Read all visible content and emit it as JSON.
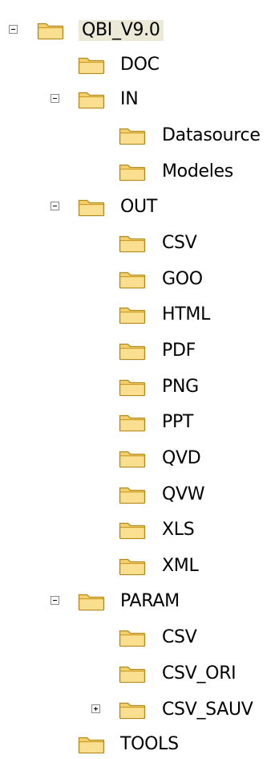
{
  "tree": {
    "root": {
      "label": "QBI_V9.0",
      "expanded": true
    },
    "doc": {
      "label": "DOC"
    },
    "in": {
      "label": "IN",
      "expanded": true
    },
    "in_datasource": {
      "label": "Datasource"
    },
    "in_modeles": {
      "label": "Modeles"
    },
    "out": {
      "label": "OUT",
      "expanded": true
    },
    "out_csv": {
      "label": "CSV"
    },
    "out_goo": {
      "label": "GOO"
    },
    "out_html": {
      "label": "HTML"
    },
    "out_pdf": {
      "label": "PDF"
    },
    "out_png": {
      "label": "PNG"
    },
    "out_ppt": {
      "label": "PPT"
    },
    "out_qvd": {
      "label": "QVD"
    },
    "out_qvw": {
      "label": "QVW"
    },
    "out_xls": {
      "label": "XLS"
    },
    "out_xml": {
      "label": "XML"
    },
    "param": {
      "label": "PARAM",
      "expanded": true
    },
    "param_csv": {
      "label": "CSV"
    },
    "param_csv_ori": {
      "label": "CSV_ORI"
    },
    "param_csv_sauv": {
      "label": "CSV_SAUV",
      "expanded": false
    },
    "tools": {
      "label": "TOOLS"
    }
  },
  "colors": {
    "folder_fill": "#f5d06a",
    "folder_outline": "#b58a1c",
    "selection": "#ece9d8"
  },
  "icons": {
    "folder": "folder-icon",
    "expand": "expand-icon",
    "collapse": "collapse-icon"
  }
}
